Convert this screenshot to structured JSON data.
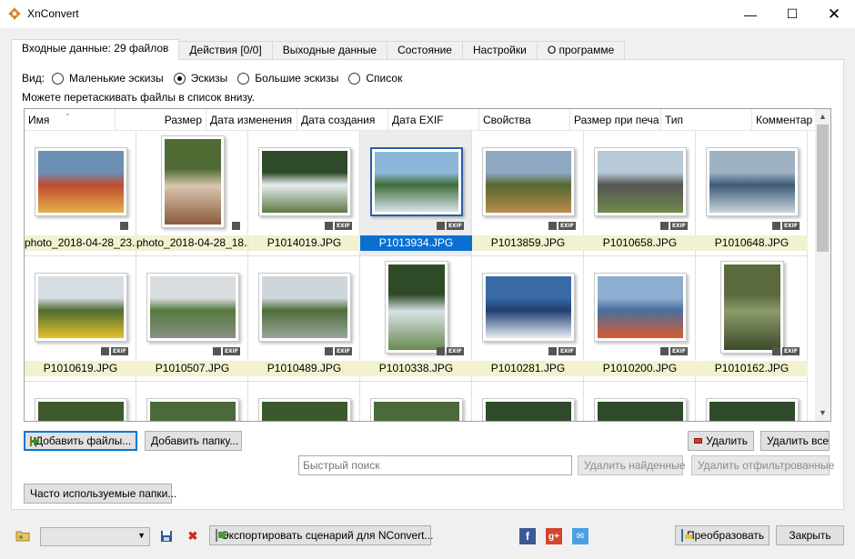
{
  "window": {
    "title": "XnConvert",
    "minimize_icon": "minimize-icon",
    "maximize_icon": "maximize-icon",
    "close_icon": "close-icon"
  },
  "tabs": [
    {
      "label": "Входные данные: 29 файлов",
      "active": true
    },
    {
      "label": "Действия [0/0]",
      "active": false
    },
    {
      "label": "Выходные данные",
      "active": false
    },
    {
      "label": "Состояние",
      "active": false
    },
    {
      "label": "Настройки",
      "active": false
    },
    {
      "label": "О программе",
      "active": false
    }
  ],
  "view": {
    "label": "Вид:",
    "options": [
      "Маленькие эскизы",
      "Эскизы",
      "Большие эскизы",
      "Список"
    ],
    "selected": "Эскизы"
  },
  "hint": "Можете перетаскивать файлы в список внизу.",
  "columns": [
    "Имя",
    "Размер",
    "Дата изменения",
    "Дата создания",
    "Дата EXIF",
    "Свойства",
    "Размер при печа",
    "Тип",
    "Комментар"
  ],
  "files": [
    {
      "name": "photo_2018-04-28_23...",
      "colors": [
        "#6b8fb3",
        "#c04a30",
        "#e2b14a"
      ],
      "orientation": "landscape",
      "exif": false,
      "selected": false
    },
    {
      "name": "photo_2018-04-28_18...",
      "colors": [
        "#4f6b33",
        "#d9c6b0",
        "#8a5a3a"
      ],
      "orientation": "portrait",
      "exif": false,
      "selected": false
    },
    {
      "name": "P1014019.JPG",
      "colors": [
        "#2f4a2a",
        "#e8eef0",
        "#5d7a44"
      ],
      "orientation": "landscape",
      "exif": true,
      "selected": false
    },
    {
      "name": "P1013934.JPG",
      "colors": [
        "#8db7d8",
        "#3f6e3a",
        "#d7e4ea"
      ],
      "orientation": "landscape",
      "exif": true,
      "selected": true
    },
    {
      "name": "P1013859.JPG",
      "colors": [
        "#8fa9c2",
        "#56672f",
        "#b88c4d"
      ],
      "orientation": "landscape",
      "exif": true,
      "selected": false
    },
    {
      "name": "P1010658.JPG",
      "colors": [
        "#b6c9d6",
        "#555",
        "#6f8a4b"
      ],
      "orientation": "landscape",
      "exif": true,
      "selected": false
    },
    {
      "name": "P1010648.JPG",
      "colors": [
        "#9fb2c2",
        "#3d5a78",
        "#c9d4dc"
      ],
      "orientation": "landscape",
      "exif": true,
      "selected": false
    },
    {
      "name": "P1010619.JPG",
      "colors": [
        "#d5dde3",
        "#4e6b30",
        "#e3c12a"
      ],
      "orientation": "landscape",
      "exif": true,
      "selected": false
    },
    {
      "name": "P1010507.JPG",
      "colors": [
        "#d9dde0",
        "#567a3e",
        "#8a8f86"
      ],
      "orientation": "landscape",
      "exif": true,
      "selected": false
    },
    {
      "name": "P1010489.JPG",
      "colors": [
        "#cfd6db",
        "#4f6e3a",
        "#9aa79a"
      ],
      "orientation": "landscape",
      "exif": true,
      "selected": false
    },
    {
      "name": "P1010338.JPG",
      "colors": [
        "#2e4a26",
        "#d8e2e8",
        "#6b8a50"
      ],
      "orientation": "portrait",
      "exif": true,
      "selected": false
    },
    {
      "name": "P1010281.JPG",
      "colors": [
        "#3a6aa5",
        "#1f3d70",
        "#e8eef4"
      ],
      "orientation": "landscape",
      "exif": true,
      "selected": false
    },
    {
      "name": "P1010200.JPG",
      "colors": [
        "#8eaed0",
        "#4a6f9d",
        "#d95a30"
      ],
      "orientation": "landscape",
      "exif": true,
      "selected": false
    },
    {
      "name": "P1010162.JPG",
      "colors": [
        "#5a6a3d",
        "#8a9a6a",
        "#3c4a2a"
      ],
      "orientation": "portrait",
      "exif": true,
      "selected": false
    },
    {
      "name": "",
      "colors": [
        "#3f5a2c",
        "#6f8a4a",
        "#2d3f20"
      ],
      "orientation": "landscape",
      "exif": false,
      "selected": false
    },
    {
      "name": "",
      "colors": [
        "#4a6a3a",
        "#aeb9a0",
        "#3a5030"
      ],
      "orientation": "landscape",
      "exif": false,
      "selected": false
    },
    {
      "name": "",
      "colors": [
        "#3a5a2e",
        "#8fa070",
        "#2a3a20"
      ],
      "orientation": "landscape",
      "exif": false,
      "selected": false
    },
    {
      "name": "",
      "colors": [
        "#4a6a3a",
        "#6c8a50",
        "#2e4220"
      ],
      "orientation": "landscape",
      "exif": false,
      "selected": false
    },
    {
      "name": "",
      "colors": [
        "#2f4a2a",
        "#e8eef0",
        "#5d7a44"
      ],
      "orientation": "landscape",
      "exif": false,
      "selected": false
    },
    {
      "name": "",
      "colors": [
        "#2f4a2a",
        "#e8eef0",
        "#5d7a44"
      ],
      "orientation": "landscape",
      "exif": false,
      "selected": false
    },
    {
      "name": "",
      "colors": [
        "#2f4a2a",
        "#e8eef0",
        "#5d7a44"
      ],
      "orientation": "landscape",
      "exif": false,
      "selected": false
    }
  ],
  "buttons": {
    "add_files": "Добавить файлы...",
    "add_folder": "Добавить папку...",
    "delete": "Удалить",
    "delete_all": "Удалить все",
    "delete_found": "Удалить найденные",
    "delete_filtered": "Удалить отфильтрованные",
    "favorite_folders": "Часто используемые папки...",
    "export_script": "Экспортировать сценарий для NConvert...",
    "convert": "Преобразовать",
    "close": "Закрыть"
  },
  "search": {
    "placeholder": "Быстрый поиск"
  },
  "colors": {
    "selection": "#0a6fd0",
    "name_bg": "#f3f2d0",
    "accent": "#0078d7"
  }
}
